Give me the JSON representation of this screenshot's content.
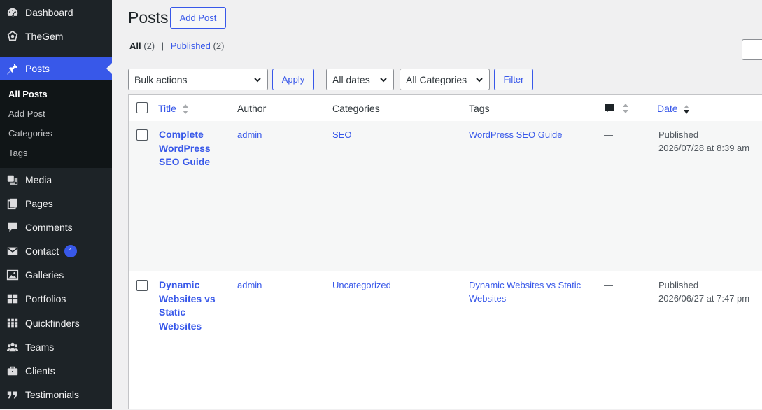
{
  "sidebar": {
    "items": [
      {
        "label": "Dashboard",
        "icon": "dashboard-icon"
      },
      {
        "label": "TheGem",
        "icon": "thegem-icon"
      },
      {
        "label": "Posts",
        "icon": "pushpin-icon"
      },
      {
        "label": "Media",
        "icon": "media-icon"
      },
      {
        "label": "Pages",
        "icon": "pages-icon"
      },
      {
        "label": "Comments",
        "icon": "comment-icon"
      },
      {
        "label": "Contact",
        "icon": "envelope-icon",
        "badge": "1"
      },
      {
        "label": "Galleries",
        "icon": "gallery-icon"
      },
      {
        "label": "Portfolios",
        "icon": "portfolio-grid-icon"
      },
      {
        "label": "Quickfinders",
        "icon": "quickfinder-grid-icon"
      },
      {
        "label": "Teams",
        "icon": "groups-icon"
      },
      {
        "label": "Clients",
        "icon": "briefcase-icon"
      },
      {
        "label": "Testimonials",
        "icon": "quote-icon"
      }
    ],
    "submenu": [
      "All Posts",
      "Add Post",
      "Categories",
      "Tags"
    ]
  },
  "header": {
    "title": "Posts",
    "add_label": "Add Post"
  },
  "filters": {
    "all_label": "All",
    "all_count": "(2)",
    "separator": "|",
    "published_label": "Published",
    "published_count": "(2)"
  },
  "toolbar": {
    "bulk_actions": "Bulk actions",
    "apply": "Apply",
    "dates": "All dates",
    "categories": "All Categories",
    "filter": "Filter"
  },
  "table": {
    "columns": {
      "title": "Title",
      "author": "Author",
      "categories": "Categories",
      "tags": "Tags",
      "date": "Date"
    },
    "rows": [
      {
        "title_lines": [
          "Complete",
          "WordPress",
          "SEO Guide"
        ],
        "author": "admin",
        "category": "SEO",
        "tag_lines": [
          "WordPress SEO Guide"
        ],
        "comments": "—",
        "status": "Published",
        "date": "2026/07/28 at 8:39 am"
      },
      {
        "title_lines": [
          "Dynamic",
          "Websites vs",
          "Static",
          "Websites"
        ],
        "author": "admin",
        "category": "Uncategorized",
        "tag_lines": [
          "Dynamic Websites vs Static",
          "Websites"
        ],
        "comments": "—",
        "status": "Published",
        "date": "2026/06/27 at 7:47 pm"
      }
    ]
  },
  "colors": {
    "accent": "#3858e9",
    "sidebar": "#1d2327"
  }
}
